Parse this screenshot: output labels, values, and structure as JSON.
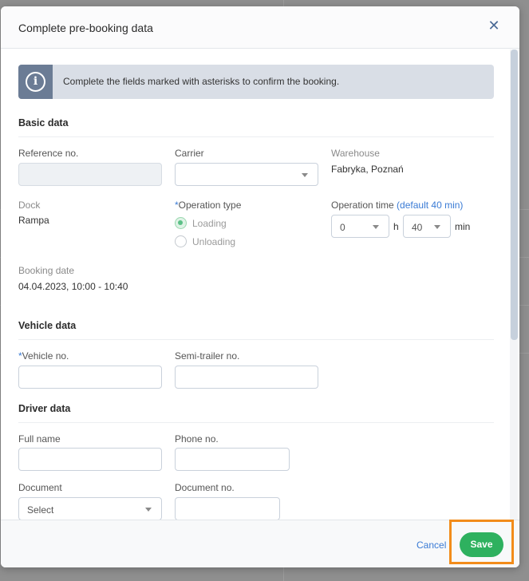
{
  "modal": {
    "title": "Complete pre-booking data",
    "close_glyph": "✕",
    "info_icon_glyph": "i",
    "info_text": "Complete the fields marked with asterisks to confirm the booking."
  },
  "basic": {
    "title": "Basic data",
    "reference_label": "Reference no.",
    "reference_value": "",
    "carrier_label": "Carrier",
    "carrier_value": "",
    "warehouse_label": "Warehouse",
    "warehouse_value": "Fabryka, Poznań",
    "dock_label": "Dock",
    "dock_value": "Rampa",
    "operation_type_asterisk": "*",
    "operation_type_label": "Operation type",
    "operation_loading": "Loading",
    "operation_unloading": "Unloading",
    "operation_selected": "Loading",
    "operation_time_label": "Operation time",
    "operation_time_default": "(default 40 min)",
    "hours_value": "0",
    "hours_unit": "h",
    "minutes_value": "40",
    "minutes_unit": "min",
    "booking_date_label": "Booking date",
    "booking_date_value": "04.04.2023, 10:00 - 10:40"
  },
  "vehicle": {
    "title": "Vehicle data",
    "vehicle_no_asterisk": "*",
    "vehicle_no_label": "Vehicle no.",
    "vehicle_no_value": "",
    "semitrailer_label": "Semi-trailer no.",
    "semitrailer_value": ""
  },
  "driver": {
    "title": "Driver data",
    "fullname_label": "Full name",
    "fullname_value": "",
    "phone_label": "Phone no.",
    "phone_value": "",
    "document_label": "Document",
    "document_select": "Select",
    "document_no_label": "Document no.",
    "document_no_value": ""
  },
  "footer": {
    "cancel_label": "Cancel",
    "save_label": "Save"
  },
  "colors": {
    "accent": "#3a7bd5",
    "save": "#2eb15f",
    "highlight": "#f28c1a",
    "banner_icon_bg": "#6b7c95"
  },
  "icons": {
    "close": "close-icon",
    "info": "info-icon",
    "caret": "chevron-down-icon"
  }
}
